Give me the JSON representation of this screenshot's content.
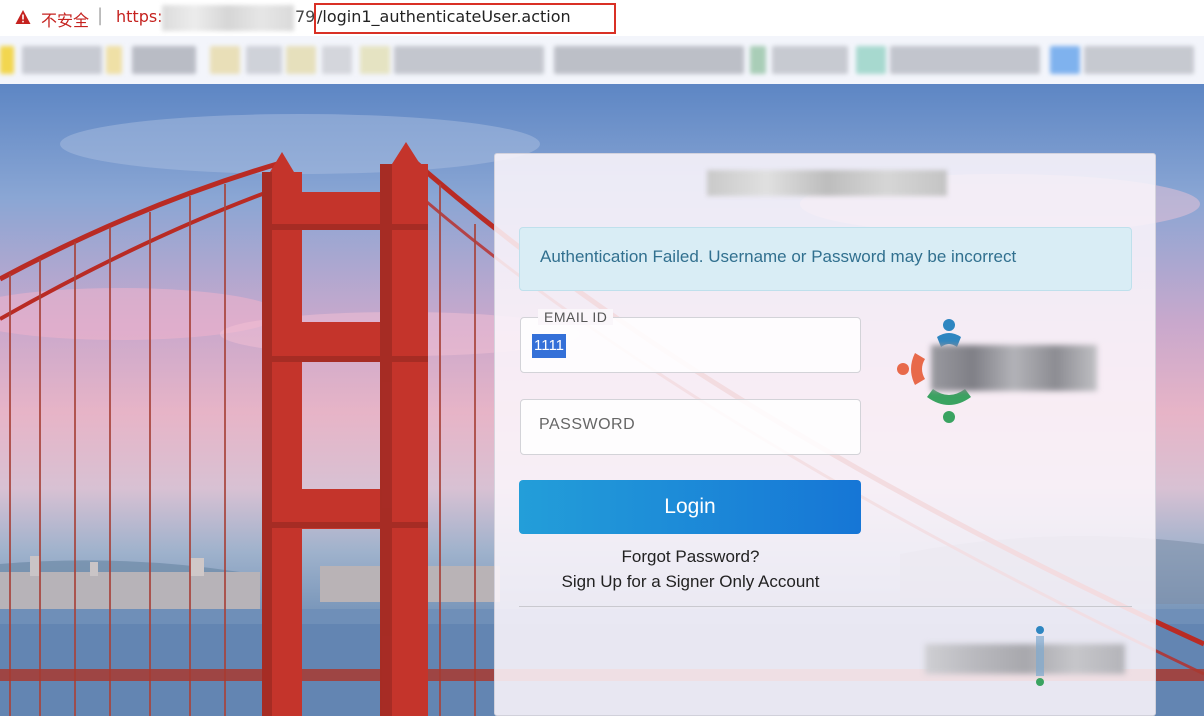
{
  "browser": {
    "security_warning": "不安全",
    "url_scheme": "https:",
    "url_port": "79",
    "url_path": "/login1_authenticateUser.action",
    "warning_color": "#c5221f",
    "highlight_color": "#d93025"
  },
  "login": {
    "alert_message": "Authentication Failed. Username or Password may be incorrect",
    "email_label": "EMAIL ID",
    "email_value": "1111",
    "password_placeholder": "PASSWORD",
    "login_button": "Login",
    "forgot_password_link": "Forgot Password?",
    "signup_link": "Sign Up for a Signer Only Account",
    "button_gradient": [
      "#239ed9",
      "#1676d6"
    ],
    "alert_bg": "#d9edf5",
    "alert_text_color": "#31708f"
  }
}
